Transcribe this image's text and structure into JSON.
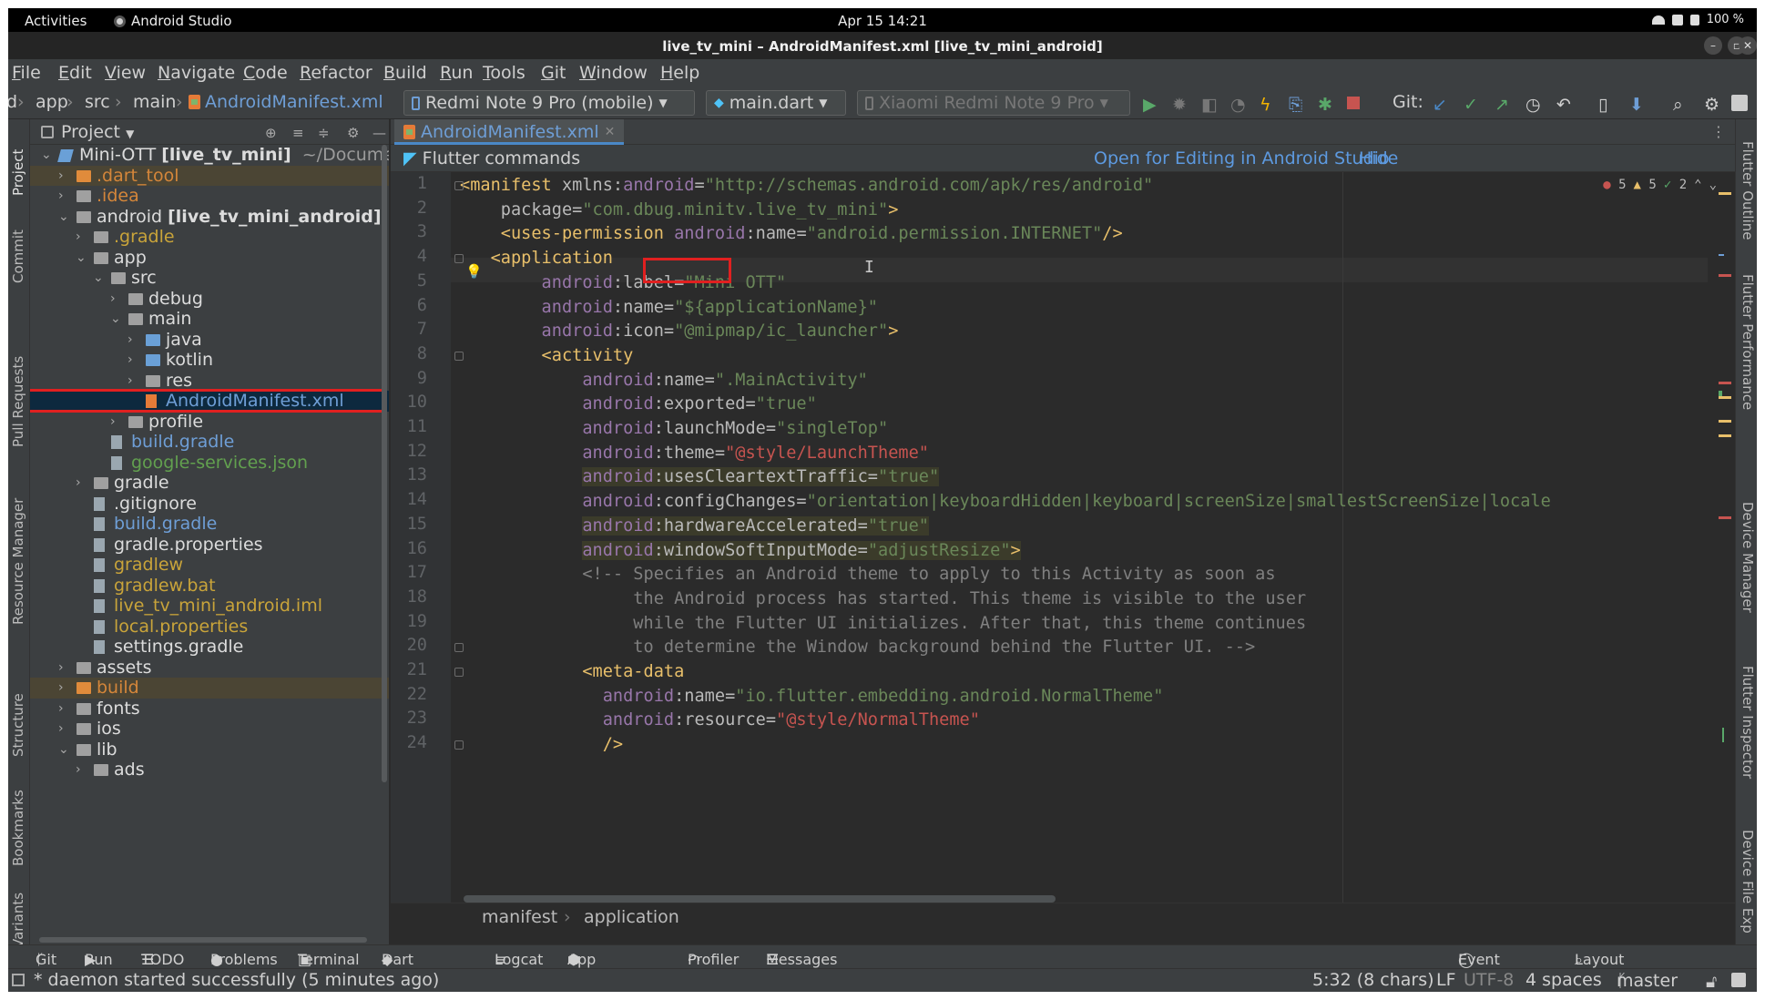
{
  "system_bar": {
    "activities": "Activities",
    "app_name": "Android Studio",
    "clock": "Apr 15  14:21",
    "battery": "100 %"
  },
  "window": {
    "title": "live_tv_mini – AndroidManifest.xml [live_tv_mini_android]"
  },
  "menu": [
    "File",
    "Edit",
    "View",
    "Navigate",
    "Code",
    "Refactor",
    "Build",
    "Run",
    "Tools",
    "Git",
    "Window",
    "Help"
  ],
  "toolbar": {
    "breadcrumbs": [
      "d",
      "app",
      "src",
      "main",
      "AndroidManifest.xml"
    ],
    "device_combo": "Redmi Note 9 Pro (mobile)",
    "run_config": "main.dart",
    "target_device": "Xiaomi Redmi Note 9 Pro",
    "git_label": "Git:"
  },
  "left_tools": [
    "Project",
    "Commit",
    "Pull Requests",
    "Resource Manager",
    "Structure",
    "Bookmarks",
    "Variants"
  ],
  "right_tools": [
    "Flutter Outline",
    "Flutter Performance",
    "Device Manager",
    "Flutter Inspector",
    "Device File Exp"
  ],
  "project": {
    "title": "Project",
    "tree": [
      {
        "label": "Mini-OTT",
        "bold": "[live_tv_mini]",
        "suffix": " ~/Documents/Mini-OTT",
        "depth": 0,
        "arrow": "v",
        "icon": "module",
        "color": "white"
      },
      {
        "label": ".dart_tool",
        "depth": 1,
        "arrow": ">",
        "icon": "orange",
        "color": "orange",
        "excluded": true
      },
      {
        "label": ".idea",
        "depth": 1,
        "arrow": ">",
        "icon": "gray",
        "color": "orange"
      },
      {
        "label": "android",
        "bold": "[live_tv_mini_android]",
        "depth": 1,
        "arrow": "v",
        "icon": "gray",
        "color": "white"
      },
      {
        "label": ".gradle",
        "depth": 2,
        "arrow": ">",
        "icon": "gray",
        "color": "yellow"
      },
      {
        "label": "app",
        "depth": 2,
        "arrow": "v",
        "icon": "gray",
        "color": "white"
      },
      {
        "label": "src",
        "depth": 3,
        "arrow": "v",
        "icon": "gray",
        "color": "white"
      },
      {
        "label": "debug",
        "depth": 4,
        "arrow": ">",
        "icon": "gray",
        "color": "white"
      },
      {
        "label": "main",
        "depth": 4,
        "arrow": "v",
        "icon": "gray",
        "color": "white"
      },
      {
        "label": "java",
        "depth": 5,
        "arrow": ">",
        "icon": "blue",
        "color": "white"
      },
      {
        "label": "kotlin",
        "depth": 5,
        "arrow": ">",
        "icon": "blue",
        "color": "white"
      },
      {
        "label": "res",
        "depth": 5,
        "arrow": ">",
        "icon": "gray",
        "color": "white"
      },
      {
        "label": "AndroidManifest.xml",
        "depth": 5,
        "arrow": "",
        "icon": "xml",
        "color": "blue",
        "selected": true
      },
      {
        "label": "profile",
        "depth": 4,
        "arrow": ">",
        "icon": "gray",
        "color": "white"
      },
      {
        "label": "build.gradle",
        "depth": 3,
        "arrow": "",
        "icon": "file",
        "color": "blue"
      },
      {
        "label": "google-services.json",
        "depth": 3,
        "arrow": "",
        "icon": "file",
        "color": "green"
      },
      {
        "label": "gradle",
        "depth": 2,
        "arrow": ">",
        "icon": "gray",
        "color": "white"
      },
      {
        "label": ".gitignore",
        "depth": 2,
        "arrow": "",
        "icon": "file",
        "color": "white"
      },
      {
        "label": "build.gradle",
        "depth": 2,
        "arrow": "",
        "icon": "file",
        "color": "blue"
      },
      {
        "label": "gradle.properties",
        "depth": 2,
        "arrow": "",
        "icon": "file",
        "color": "white"
      },
      {
        "label": "gradlew",
        "depth": 2,
        "arrow": "",
        "icon": "file",
        "color": "yellow"
      },
      {
        "label": "gradlew.bat",
        "depth": 2,
        "arrow": "",
        "icon": "file",
        "color": "yellow"
      },
      {
        "label": "live_tv_mini_android.iml",
        "depth": 2,
        "arrow": "",
        "icon": "file",
        "color": "yellow"
      },
      {
        "label": "local.properties",
        "depth": 2,
        "arrow": "",
        "icon": "file",
        "color": "yellow"
      },
      {
        "label": "settings.gradle",
        "depth": 2,
        "arrow": "",
        "icon": "file",
        "color": "white"
      },
      {
        "label": "assets",
        "depth": 1,
        "arrow": ">",
        "icon": "gray",
        "color": "white"
      },
      {
        "label": "build",
        "depth": 1,
        "arrow": ">",
        "icon": "orange",
        "color": "orange",
        "excluded": true
      },
      {
        "label": "fonts",
        "depth": 1,
        "arrow": ">",
        "icon": "gray",
        "color": "white"
      },
      {
        "label": "ios",
        "depth": 1,
        "arrow": ">",
        "icon": "gray",
        "color": "white"
      },
      {
        "label": "lib",
        "depth": 1,
        "arrow": "v",
        "icon": "gray",
        "color": "white"
      },
      {
        "label": "ads",
        "depth": 2,
        "arrow": ">",
        "icon": "gray",
        "color": "white"
      }
    ]
  },
  "editor": {
    "tab": "AndroidManifest.xml",
    "flutter_bar": {
      "title": "Flutter commands",
      "open_link": "Open for Editing in Android Studio",
      "hide_link": "Hide"
    },
    "inspection": {
      "errors": "5",
      "warnings": "5",
      "ok": "2"
    },
    "lines": [
      {
        "n": "1",
        "tokens": [
          [
            "tag",
            "<manifest "
          ],
          [
            "attr",
            "xmlns:"
          ],
          [
            "ns",
            "android"
          ],
          [
            "attr",
            "="
          ],
          [
            "str",
            "\"http://schemas.android.com/apk/res/android\""
          ]
        ]
      },
      {
        "n": "2",
        "tokens": [
          [
            "attr",
            "    package="
          ],
          [
            "str",
            "\"com.dbug.minitv.live_tv_mini\""
          ],
          [
            "tag",
            ">"
          ]
        ]
      },
      {
        "n": "3",
        "tokens": [
          [
            "tag",
            "    <uses-permission "
          ],
          [
            "ns",
            "android"
          ],
          [
            "attr",
            ":name="
          ],
          [
            "str",
            "\"android.permission.INTERNET\""
          ],
          [
            "tag",
            "/>"
          ]
        ]
      },
      {
        "n": "4",
        "tokens": [
          [
            "tag",
            "   <application"
          ]
        ]
      },
      {
        "n": "5",
        "tokens": [
          [
            "ns",
            "        android"
          ],
          [
            "attr",
            ":label="
          ],
          [
            "str",
            "\"Mini OTT\""
          ]
        ]
      },
      {
        "n": "6",
        "tokens": [
          [
            "ns",
            "        android"
          ],
          [
            "attr",
            ":name="
          ],
          [
            "str",
            "\"${applicationName}\""
          ]
        ]
      },
      {
        "n": "7",
        "tokens": [
          [
            "ns",
            "        android"
          ],
          [
            "attr",
            ":icon="
          ],
          [
            "str",
            "\"@mipmap/ic_launcher\""
          ],
          [
            "tag",
            ">"
          ]
        ]
      },
      {
        "n": "8",
        "tokens": [
          [
            "tag",
            "        <activity"
          ]
        ]
      },
      {
        "n": "9",
        "tokens": [
          [
            "ns",
            "            android"
          ],
          [
            "attr",
            ":name="
          ],
          [
            "str",
            "\".MainActivity\""
          ]
        ]
      },
      {
        "n": "10",
        "tokens": [
          [
            "ns",
            "            android"
          ],
          [
            "attr",
            ":exported="
          ],
          [
            "str",
            "\"true\""
          ]
        ]
      },
      {
        "n": "11",
        "tokens": [
          [
            "ns",
            "            android"
          ],
          [
            "attr",
            ":launchMode="
          ],
          [
            "str",
            "\"singleTop\""
          ]
        ]
      },
      {
        "n": "12",
        "tokens": [
          [
            "ns",
            "            android"
          ],
          [
            "attr",
            ":theme="
          ],
          [
            "red",
            "\"@style/LaunchTheme\""
          ]
        ]
      },
      {
        "n": "13",
        "tokens": [
          [
            "ns",
            "            android"
          ],
          [
            "attr",
            ":usesCleartextTraffic="
          ],
          [
            "str",
            "\"true\""
          ]
        ]
      },
      {
        "n": "14",
        "tokens": [
          [
            "ns",
            "            android"
          ],
          [
            "attr",
            ":configChanges="
          ],
          [
            "str",
            "\"orientation|keyboardHidden|keyboard|screenSize|smallestScreenSize|locale"
          ]
        ]
      },
      {
        "n": "15",
        "tokens": [
          [
            "ns",
            "            android"
          ],
          [
            "attr",
            ":hardwareAccelerated="
          ],
          [
            "str",
            "\"true\""
          ]
        ]
      },
      {
        "n": "16",
        "tokens": [
          [
            "ns",
            "            android"
          ],
          [
            "attr",
            ":windowSoftInputMode="
          ],
          [
            "str",
            "\"adjustResize\""
          ],
          [
            "tag",
            ">"
          ]
        ]
      },
      {
        "n": "17",
        "tokens": [
          [
            "cmt",
            "            <!-- Specifies an Android theme to apply to this Activity as soon as"
          ]
        ]
      },
      {
        "n": "18",
        "tokens": [
          [
            "cmt",
            "                 the Android process has started. This theme is visible to the user"
          ]
        ]
      },
      {
        "n": "19",
        "tokens": [
          [
            "cmt",
            "                 while the Flutter UI initializes. After that, this theme continues"
          ]
        ]
      },
      {
        "n": "20",
        "tokens": [
          [
            "cmt",
            "                 to determine the Window background behind the Flutter UI. -->"
          ]
        ]
      },
      {
        "n": "21",
        "tokens": [
          [
            "tag",
            "            <meta-data"
          ]
        ]
      },
      {
        "n": "22",
        "tokens": [
          [
            "ns",
            "              android"
          ],
          [
            "attr",
            ":name="
          ],
          [
            "str",
            "\"io.flutter.embedding.android.NormalTheme\""
          ]
        ]
      },
      {
        "n": "23",
        "tokens": [
          [
            "ns",
            "              android"
          ],
          [
            "attr",
            ":resource="
          ],
          [
            "red",
            "\"@style/NormalTheme\""
          ]
        ]
      },
      {
        "n": "24",
        "tokens": [
          [
            "tag",
            "              />"
          ]
        ]
      }
    ],
    "breadcrumb": [
      "manifest",
      "application"
    ]
  },
  "tool_windows": {
    "left": [
      "Git",
      "Run",
      "TODO",
      "Problems",
      "Terminal",
      "Dart Analysis",
      "Logcat",
      "App Inspection",
      "Profiler",
      "Messages"
    ],
    "right": [
      "Event Log",
      "Layout Inspector"
    ]
  },
  "status_bar": {
    "message": "* daemon started successfully (5 minutes ago)",
    "position": "5:32 (8 chars)",
    "line_sep": "LF",
    "encoding": "UTF-8",
    "indent": "4 spaces",
    "branch": "master"
  }
}
